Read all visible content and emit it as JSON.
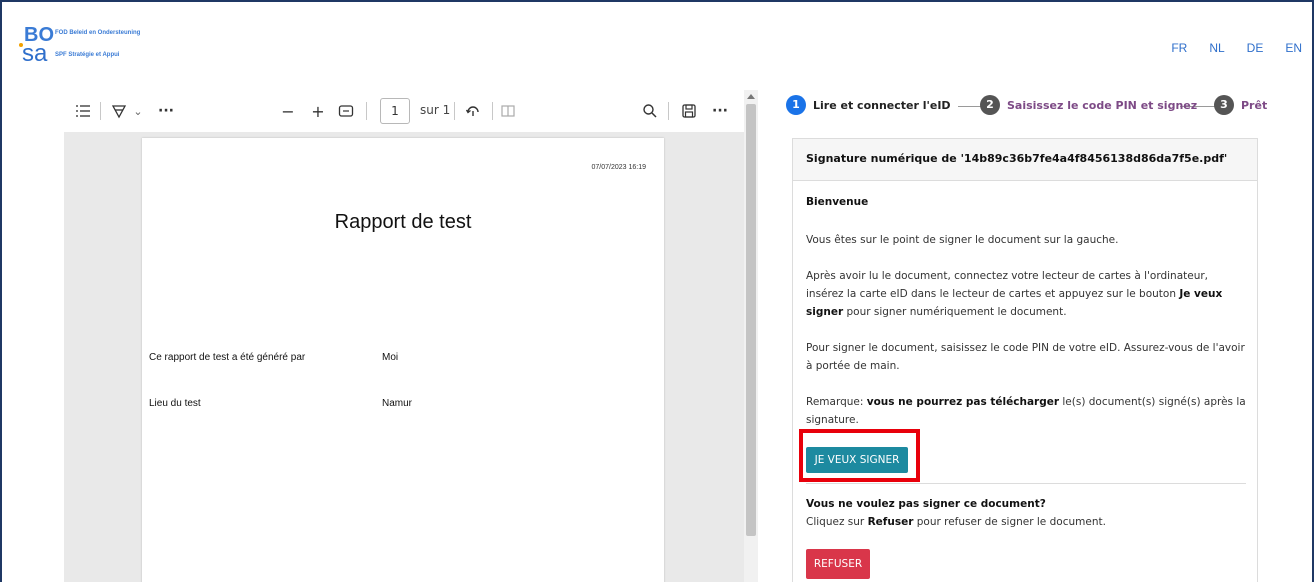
{
  "header": {
    "logo_top": "BO",
    "logo_bottom": "sa",
    "logo_line1": "FOD Beleid en Ondersteuning",
    "logo_line2": "SPF Stratégie et Appui",
    "languages": [
      "FR",
      "NL",
      "DE",
      "EN"
    ]
  },
  "viewer": {
    "toolbar": {
      "contents_icon": "list-icon",
      "draw_icon": "draw-icon",
      "chevron": "⌄",
      "more": "···",
      "zoom_out": "−",
      "zoom_in": "+",
      "fit_icon": "fit-page-icon",
      "page_number": "1",
      "page_total": "sur 1",
      "rotate_icon": "rotate-icon",
      "two_page_icon": "two-page-icon",
      "search_icon": "search-icon",
      "save_icon": "save-icon",
      "more_right": "···"
    },
    "page": {
      "date": "07/07/2023 16:19",
      "title": "Rapport de test",
      "row1_label": "Ce rapport de test a été généré par",
      "row1_value": "Moi",
      "row2_label": "Lieu du test",
      "row2_value": "Namur"
    }
  },
  "stepper": {
    "steps": [
      {
        "num": "1",
        "label": "Lire et connecter l'eID",
        "color": "#1a73e8",
        "text_color": "#222222"
      },
      {
        "num": "2",
        "label": "Saisissez le code PIN et signez",
        "color": "#555555",
        "text_color": "#7d4a86"
      },
      {
        "num": "3",
        "label": "Prêt",
        "color": "#555555",
        "text_color": "#7d4a86"
      }
    ]
  },
  "panel": {
    "heading": "Signature numérique de '14b89c36b7fe4a4f8456138d86da7f5e.pdf'",
    "welcome": "Bienvenue",
    "p1": "Vous êtes sur le point de signer le document sur la gauche.",
    "p2_a": "Après avoir lu le document, connectez votre lecteur de cartes à l'ordinateur, insérez la carte eID dans le lecteur de cartes et appuyez sur le bouton ",
    "p2_b": "Je veux signer",
    "p2_c": " pour signer numériquement le document.",
    "p3": "Pour signer le document, saisissez le code PIN de votre eID. Assurez-vous de l'avoir à portée de main.",
    "note_a": "Remarque: ",
    "note_b": "vous ne pourrez pas télécharger",
    "note_c": " le(s) document(s) signé(s) après la signature.",
    "sign_button": "JE VEUX SIGNER",
    "decline_heading": "Vous ne voulez pas signer ce document?",
    "decline_a": "Cliquez sur ",
    "decline_b": "Refuser",
    "decline_c": " pour refuser de signer le document.",
    "refuse_button": "REFUSER"
  },
  "colors": {
    "sign_button": "#1d8aa0",
    "refuse_button": "#d9364a",
    "highlight": "#e8000b",
    "frame": "#1f3864"
  }
}
